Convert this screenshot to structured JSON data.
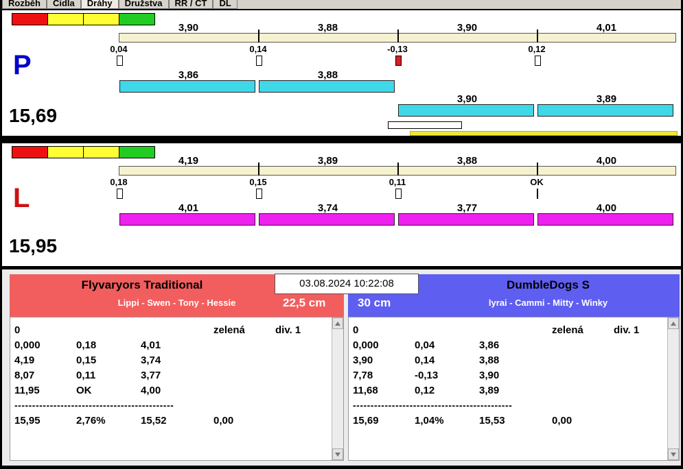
{
  "tabbar": {
    "tabs": [
      {
        "label": "Rozběh",
        "active": false
      },
      {
        "label": "Čidla",
        "active": false
      },
      {
        "label": "Dráhy",
        "active": true
      },
      {
        "label": "Družstva",
        "active": false
      },
      {
        "label": "RR / ČT",
        "active": false
      },
      {
        "label": "DL",
        "active": false
      }
    ]
  },
  "traffic_colors": [
    "#ee1111",
    "#ffff33",
    "#ffff33",
    "#22cc22"
  ],
  "lanes": [
    {
      "letter": "P",
      "letter_color": "#0000cc",
      "total": "15,69",
      "top_values": [
        "3,90",
        "3,88",
        "3,90",
        "4,01"
      ],
      "deltas": [
        {
          "value": "0,04",
          "marker": "box"
        },
        {
          "value": "0,14",
          "marker": "box"
        },
        {
          "value": "-0,13",
          "marker": "box-red"
        },
        {
          "value": "0,12",
          "marker": "box"
        }
      ],
      "bar_color": "#3fd8e8",
      "bars": [
        {
          "value": "3,86",
          "row": 0,
          "seg": 0
        },
        {
          "value": "3,88",
          "row": 0,
          "seg": 1
        },
        {
          "value": "3,90",
          "row": 1,
          "seg": 2
        },
        {
          "value": "3,89",
          "row": 1,
          "seg": 3
        }
      ],
      "extras": {
        "white_box": true,
        "yellow_bar": true
      }
    },
    {
      "letter": "L",
      "letter_color": "#cc1111",
      "total": "15,95",
      "top_values": [
        "4,19",
        "3,89",
        "3,88",
        "4,00"
      ],
      "deltas": [
        {
          "value": "0,18",
          "marker": "box"
        },
        {
          "value": "0,15",
          "marker": "box"
        },
        {
          "value": "0,11",
          "marker": "box"
        },
        {
          "value": "OK",
          "marker": "line"
        }
      ],
      "bar_color": "#ee22ee",
      "bars": [
        {
          "value": "4,01",
          "row": 0,
          "seg": 0
        },
        {
          "value": "3,74",
          "row": 0,
          "seg": 1
        },
        {
          "value": "3,77",
          "row": 0,
          "seg": 2
        },
        {
          "value": "4,00",
          "row": 0,
          "seg": 3
        }
      ],
      "extras": {}
    }
  ],
  "timestamp": "03.08.2024 10:22:08",
  "teams": [
    {
      "side": "left",
      "name": "Flyvaryors Traditional",
      "dogs": "Lippi - Swen - Tony - Hessie",
      "height": "22,5 cm",
      "header_color": "#f25e5e",
      "rows": [
        [
          "0",
          "",
          "",
          "zelená",
          "div. 1"
        ],
        [
          "0,000",
          "0,18",
          "4,01",
          "",
          ""
        ],
        [
          "4,19",
          "0,15",
          "3,74",
          "",
          ""
        ],
        [
          "8,07",
          "0,11",
          "3,77",
          "",
          ""
        ],
        [
          "11,95",
          "OK",
          "4,00",
          "",
          ""
        ]
      ],
      "dashes": "---------------------------------------------",
      "totals": [
        "15,95",
        "2,76%",
        "15,52",
        "0,00"
      ]
    },
    {
      "side": "right",
      "name": "DumbleDogs S",
      "dogs": "lyrai - Cammi - Mitty - Winky",
      "height": "30 cm",
      "header_color": "#5e5ef0",
      "rows": [
        [
          "0",
          "",
          "",
          "zelená",
          "div. 1"
        ],
        [
          "0,000",
          "0,04",
          "3,86",
          "",
          ""
        ],
        [
          "3,90",
          "0,14",
          "3,88",
          "",
          ""
        ],
        [
          "7,78",
          "-0,13",
          "3,90",
          "",
          ""
        ],
        [
          "11,68",
          "0,12",
          "3,89",
          "",
          ""
        ]
      ],
      "dashes": "---------------------------------------------",
      "totals": [
        "15,69",
        "1,04%",
        "15,53",
        "0,00"
      ]
    }
  ]
}
